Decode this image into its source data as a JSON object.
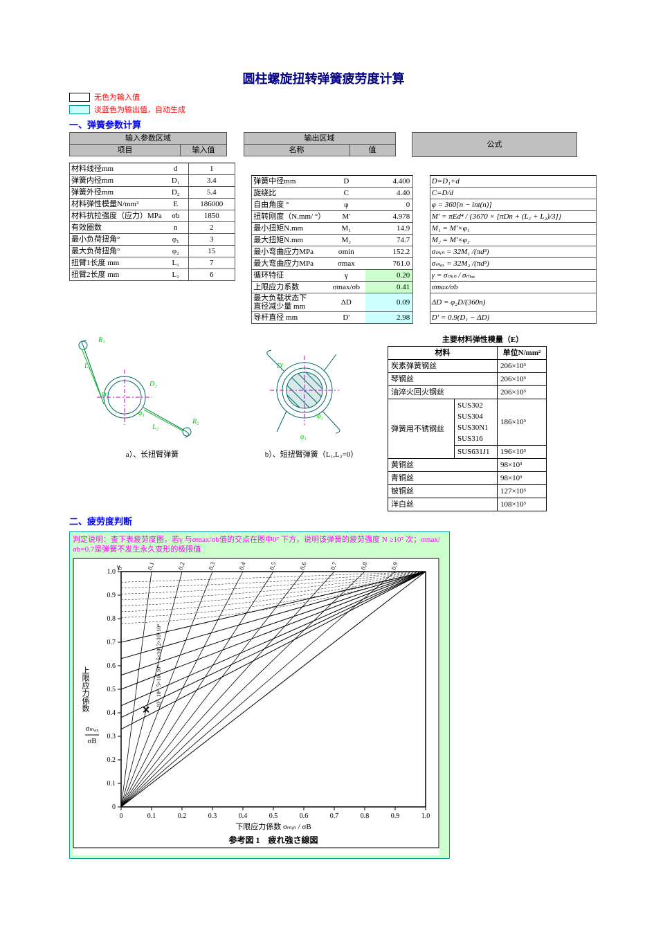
{
  "title": "圆柱螺旋扭转弹簧疲劳度计算",
  "legend": {
    "nocolor": "无色为输入值",
    "lightblue": "淡蓝色为输出值，自动生成"
  },
  "section1": "一、弹簧参数计算",
  "header": {
    "input_area": "输入参数区域",
    "input_item": "项目",
    "input_val": "输入值",
    "output_area": "输出区域",
    "output_name": "名称",
    "output_val": "值",
    "formula": "公式"
  },
  "inputs": [
    {
      "label": "材料线径mm",
      "sym": "d",
      "val": "1"
    },
    {
      "label": "弹簧内径mm",
      "sym": "D₁",
      "val": "3.4"
    },
    {
      "label": "弹簧外径mm",
      "sym": "D₂",
      "val": "5.4"
    },
    {
      "label": "材料弹性模量N/mm²",
      "sym": "E",
      "val": "186000"
    },
    {
      "label": "材料抗拉强度（应力）MPa",
      "sym": "σb",
      "val": "1850"
    },
    {
      "label": "有效圈数",
      "sym": "n",
      "val": "2"
    },
    {
      "label": "最小负荷扭角°",
      "sym": "φ₁",
      "val": "3"
    },
    {
      "label": "最大负荷扭角°",
      "sym": "φ₂",
      "val": "15"
    },
    {
      "label": "扭臂1长度 mm",
      "sym": "L₁",
      "val": "7"
    },
    {
      "label": "扭臂2长度 mm",
      "sym": "L₂",
      "val": "6"
    }
  ],
  "outputs": [
    {
      "label": "弹簧中径mm",
      "sym": "D",
      "val": "4.400",
      "cls": "out-white",
      "fm": "D=D₁+d"
    },
    {
      "label": "旋绕比",
      "sym": "C",
      "val": "4.40",
      "cls": "out-white",
      "fm": "C=D/d"
    },
    {
      "label": "自由角度 °",
      "sym": "φ",
      "val": "0",
      "cls": "out-white",
      "fm": "φ = 360[n − int(n)]"
    },
    {
      "label": "扭转刚度（N.mm/ °）",
      "sym": "M'",
      "val": "4.978",
      "cls": "out-white",
      "fm": "M' = πEd⁴ / {3670 × [πDn + (L₁ + L₂)/3]}"
    },
    {
      "label": "最小扭矩N.mm",
      "sym": "M₁",
      "val": "14.9",
      "cls": "out-white",
      "fm": "M₁ = M'×φ₁"
    },
    {
      "label": "最大扭矩N.mm",
      "sym": "M₂",
      "val": "74.7",
      "cls": "out-white",
      "fm": "M₂ = M'×φ₂"
    },
    {
      "label": "最小弯曲应力MPa",
      "sym": "σmin",
      "val": "152.2",
      "cls": "out-white",
      "fm": "σₘᵢₙ = 32M₁ /(πd³)"
    },
    {
      "label": "最大弯曲应力MPa",
      "sym": "σmax",
      "val": "761.0",
      "cls": "out-white",
      "fm": "σₘₐₓ = 32M₂ /(πd³)"
    },
    {
      "label": "循环特征",
      "sym": "γ",
      "val": "0.20",
      "cls": "out-green",
      "fm": "γ = σₘᵢₙ / σₘₐₓ"
    },
    {
      "label": "上限应力系数",
      "sym": "σmax/σb",
      "val": "0.41",
      "cls": "out-green",
      "fm": "σmax/σb"
    },
    {
      "label": "最大负载状态下\n直径减少量 mm",
      "sym": "ΔD",
      "val": "0.09",
      "cls": "out-cyan",
      "fm": "ΔD = φ₂D/(360n)"
    },
    {
      "label": "导杆直径 mm",
      "sym": "D'",
      "val": "2.98",
      "cls": "out-cyan",
      "fm": "D' = 0.9(D₁ − ΔD)"
    }
  ],
  "figcap_a": "a）、长扭臂弹簧",
  "figcap_b": "b）、短扭臂弹簧（L₁,L₂=0）",
  "material": {
    "title": "主要材料弹性模量（E）",
    "head_mat": "材料",
    "head_unit": "单位N/mm²",
    "rows": [
      {
        "name": "炭素弹簧钢丝",
        "val": "206×10³"
      },
      {
        "name": "琴钢丝",
        "val": "206×10³"
      },
      {
        "name": "油淬火回火钢丝",
        "val": "206×10³"
      }
    ],
    "sus_name": "弹簧用不锈钢丝",
    "sus_codes": "SUS302\nSUS304\nSUS30N1\nSUS316",
    "sus_val": "186×10³",
    "sus631_name": "SUS631J1",
    "sus631_val": "196×10³",
    "tail": [
      {
        "name": "黄铜丝",
        "val": "98×10³"
      },
      {
        "name": "青铜丝",
        "val": "98×10³"
      },
      {
        "name": "铍铜丝",
        "val": "127×10³"
      },
      {
        "name": "洋白丝",
        "val": "108×10³"
      }
    ]
  },
  "section2": "二、疲劳度判断",
  "fatigue_note": "判定说明：查下表疲劳度图，若γ 与σmax/σb值的交点在图中0⁷ 下方，说明该弹簧的疲劳强度 N ≥10⁷ 次；σmax/σb=0.7是弹簧不发生永久变形的极限值",
  "chart_data": {
    "type": "line",
    "title": "参考図 1　疲れ強さ線図",
    "xlabel": "下限应力係数  σₘᵢₙ / σB",
    "ylabel": "上限应力係数  σₘₐₓ / σB",
    "xlim": [
      0,
      1.0
    ],
    "ylim": [
      0,
      1.0
    ],
    "xticks": [
      0,
      0.1,
      0.2,
      0.3,
      0.4,
      0.5,
      0.6,
      0.7,
      0.8,
      0.9,
      1.0
    ],
    "yticks": [
      0,
      0.1,
      0.2,
      0.3,
      0.4,
      0.5,
      0.6,
      0.7,
      0.8,
      0.9,
      1.0
    ],
    "series": [
      {
        "name": "γ=0",
        "type": "ray",
        "slope": "vertical-ish from origin",
        "label_at_top": "0"
      },
      {
        "name": "γ=0.1",
        "type": "ray",
        "label_at_top": "0.1"
      },
      {
        "name": "γ=0.2",
        "type": "ray",
        "label_at_top": "0.2"
      },
      {
        "name": "γ=0.3",
        "type": "ray",
        "label_at_top": "0.3"
      },
      {
        "name": "γ=0.4",
        "type": "ray",
        "label_at_top": "0.4"
      },
      {
        "name": "γ=0.5",
        "type": "ray",
        "label_at_top": "0.5"
      },
      {
        "name": "γ=0.6",
        "type": "ray",
        "label_at_top": "0.6"
      },
      {
        "name": "γ=0.7",
        "type": "ray",
        "label_at_top": "0.7"
      },
      {
        "name": "γ=0.8",
        "type": "ray",
        "label_at_top": "0.8"
      },
      {
        "name": "γ=0.9",
        "type": "ray",
        "label_at_top": "0.9"
      },
      {
        "name": "diag",
        "type": "line",
        "points": [
          [
            0,
            0
          ],
          [
            1.0,
            1.0
          ]
        ]
      },
      {
        "name": "N=10⁴",
        "type": "fatigue",
        "y0": 0.7,
        "converge": [
          1.0,
          1.0
        ]
      },
      {
        "name": "N=2×10⁴",
        "type": "fatigue",
        "y0": 0.63,
        "converge": [
          1.0,
          1.0
        ]
      },
      {
        "name": "N=5×10⁴",
        "type": "fatigue",
        "y0": 0.56,
        "converge": [
          1.0,
          1.0
        ]
      },
      {
        "name": "N=10⁵",
        "type": "fatigue",
        "y0": 0.5,
        "converge": [
          1.0,
          1.0
        ]
      },
      {
        "name": "N=5×10⁵",
        "type": "fatigue",
        "y0": 0.43,
        "converge": [
          1.0,
          1.0
        ]
      },
      {
        "name": "N=10⁶",
        "type": "fatigue",
        "y0": 0.38,
        "converge": [
          1.0,
          1.0
        ]
      },
      {
        "name": "N=10⁷",
        "type": "fatigue",
        "y0": 0.33,
        "converge": [
          1.0,
          1.0
        ]
      }
    ],
    "fatigue_labels_column": [
      "10⁴",
      "2×10⁴",
      "5×10⁴",
      "10⁵",
      "5×10⁵",
      "10⁶",
      "10⁷"
    ],
    "marker": {
      "x": 0.2,
      "y": 0.41,
      "shape": "x"
    }
  }
}
